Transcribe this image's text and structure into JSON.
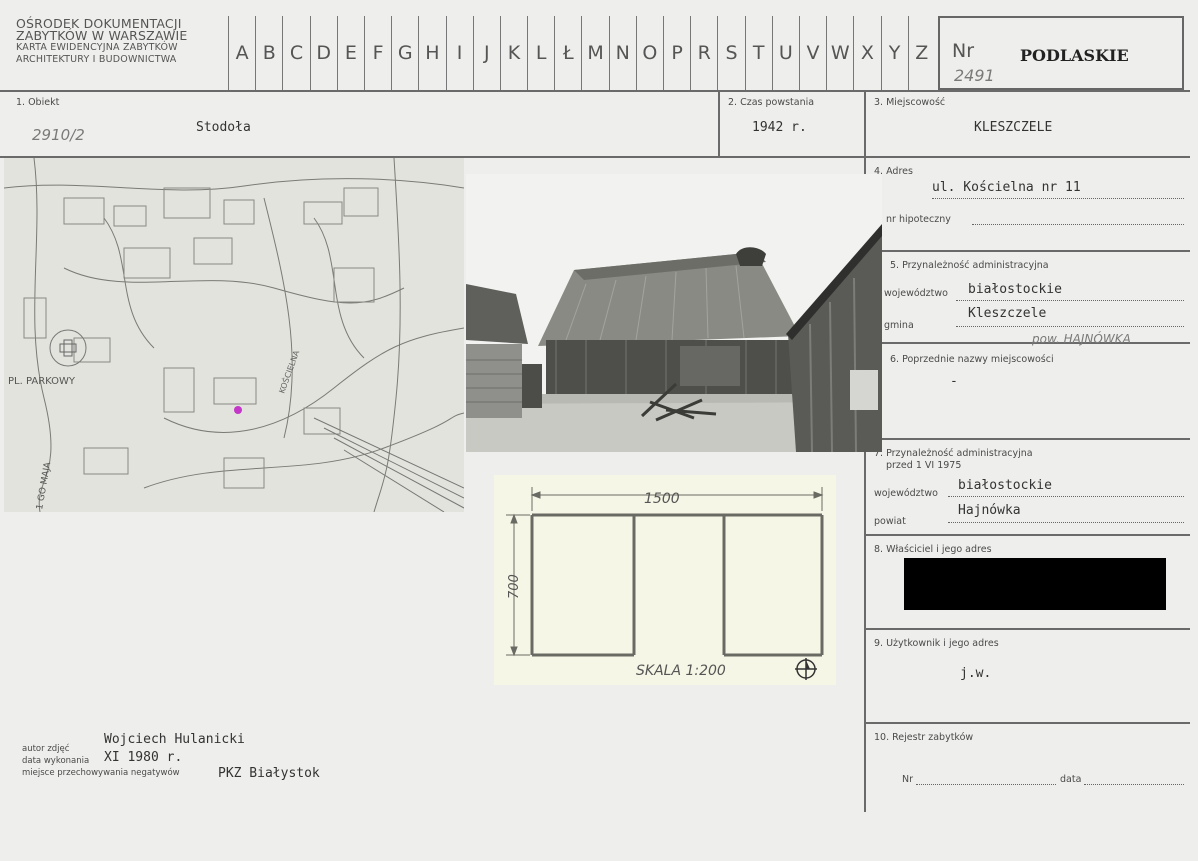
{
  "institution": {
    "line1": "OŚRODEK DOKUMENTACJI",
    "line2": "ZABYTKÓW W WARSZAWIE",
    "line3": "KARTA EWIDENCYJNA ZABYTKÓW",
    "line4": "ARCHITEKTURY I BUDOWNICTWA"
  },
  "alphabet": [
    "A",
    "B",
    "C",
    "D",
    "E",
    "F",
    "G",
    "H",
    "I",
    "J",
    "K",
    "L",
    "Ł",
    "M",
    "N",
    "O",
    "P",
    "R",
    "S",
    "T",
    "U",
    "V",
    "W",
    "X",
    "Y",
    "Z"
  ],
  "nr": {
    "label": "Nr",
    "value": "2491",
    "region": "PODLASKIE"
  },
  "fields": {
    "obiekt_label": "1. Obiekt",
    "obiekt_value": "Stodoła",
    "obiekt_note": "2910/2",
    "czas_label": "2. Czas powstania",
    "czas_value": "1942 r.",
    "miejscowosc_label": "3. Miejscowość",
    "miejscowosc_value": "KLESZCZELE",
    "adres_label": "4. Adres",
    "adres_value": "ul. Kościelna nr 11",
    "hipoteczny_label": "nr hipoteczny",
    "przyn_label": "5. Przynależność administracyjna",
    "woj_label": "województwo",
    "woj_value": "białostockie",
    "gmina_label": "gmina",
    "gmina_value": "Kleszczele",
    "gmina_note": "pow. HAJNÓWKA",
    "poprz_label": "6. Poprzednie nazwy miejscowości",
    "poprz_value": "-",
    "przyn75_label1": "7. Przynależność administracyjna",
    "przyn75_label2": "przed 1 VI 1975",
    "woj75_label": "województwo",
    "woj75_value": "białostockie",
    "powiat_label": "powiat",
    "powiat_value": "Hajnówka",
    "wlasciciel_label": "8. Właściciel i jego adres",
    "uzytkownik_label": "9. Użytkownik i jego adres",
    "uzytkownik_value": "j.w.",
    "rejestr_label": "10. Rejestr zabytków",
    "rejestr_nr": "Nr",
    "rejestr_data": "data"
  },
  "map": {
    "label1": "PL. PARKOWY",
    "label2": "1 GO MAJA",
    "label3": "KOŚCIELNA"
  },
  "plan": {
    "width": "1500",
    "height": "700",
    "scale": "SKALA 1:200"
  },
  "footer": {
    "autor_label": "autor zdjęć",
    "autor_value": "Wojciech Hulanicki",
    "data_label": "data wykonania",
    "data_value": "XI 1980 r.",
    "miejsce_label": "miejsce przechowywania negatywów",
    "miejsce_value": "PKZ Białystok"
  }
}
